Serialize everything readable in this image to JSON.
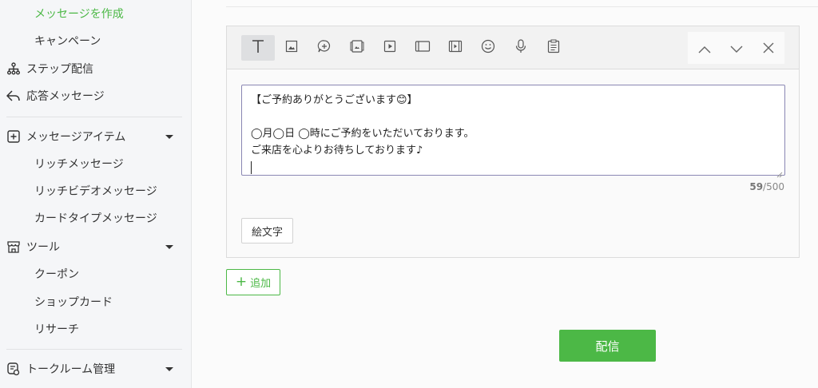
{
  "sidebar": {
    "items": [
      {
        "label": "メッセージを作成",
        "icon": "none"
      },
      {
        "label": "キャンペーン",
        "icon": "none"
      },
      {
        "label": "ステップ配信",
        "icon": "hierarchy-icon"
      },
      {
        "label": "応答メッセージ",
        "icon": "reply-icon"
      },
      {
        "label": "メッセージアイテム",
        "icon": "plus-square-icon"
      },
      {
        "label": "リッチメッセージ",
        "icon": "none"
      },
      {
        "label": "リッチビデオメッセージ",
        "icon": "none"
      },
      {
        "label": "カードタイプメッセージ",
        "icon": "none"
      },
      {
        "label": "ツール",
        "icon": "shop-icon"
      },
      {
        "label": "クーポン",
        "icon": "none"
      },
      {
        "label": "ショップカード",
        "icon": "none"
      },
      {
        "label": "リサーチ",
        "icon": "none"
      },
      {
        "label": "トークルーム管理",
        "icon": "chat-settings-icon"
      }
    ],
    "active_color": "#4cb846"
  },
  "editor": {
    "toolbar_icons": [
      "text-icon",
      "image-icon",
      "sticker-icon",
      "coupon-icon",
      "video-icon",
      "card-icon",
      "rich-video-icon",
      "emoji-icon",
      "voice-icon",
      "research-icon"
    ],
    "message_lines": [
      "【ご予約ありがとうございます😊】",
      "",
      "◯月◯日 ◯時にご予約をいただいております。",
      "ご来店を心よりお待ちしております♪"
    ],
    "char_count": "59",
    "char_limit": "/500",
    "emoji_button": "絵文字"
  },
  "actions": {
    "add_label": "追加",
    "add_symbol": "+",
    "send_label": "配信"
  },
  "colors": {
    "accent": "#4cb846",
    "textarea_border": "#8a87b3"
  }
}
